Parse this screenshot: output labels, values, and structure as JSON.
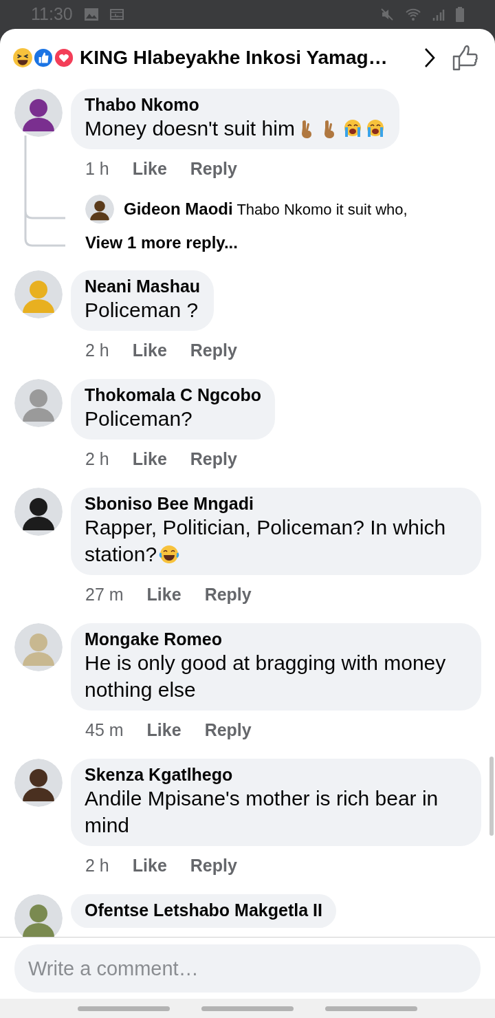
{
  "status_bar": {
    "time": "11:30"
  },
  "header": {
    "reactions": [
      {
        "kind": "haha"
      },
      {
        "kind": "like"
      },
      {
        "kind": "love"
      }
    ],
    "title": "KING Hlabeyakhe Inkosi Yamag…"
  },
  "comments": [
    {
      "author": "Thabo Nkomo",
      "text": "Money doesn't suit him",
      "emoji": [
        {
          "kind": "fingers"
        },
        {
          "kind": "fingers"
        },
        {
          "kind": "crying"
        },
        {
          "kind": "crying"
        }
      ],
      "time": "1 h",
      "like": "Like",
      "reply": "Reply",
      "color": "#7a2f8f",
      "replies": [
        {
          "author": "Gideon Maodi",
          "text": "Thabo Nkomo it suit who,",
          "color": "#5a3a1a"
        }
      ],
      "more_replies": "View 1 more reply..."
    },
    {
      "author": "Neani Mashau",
      "text": "Policeman ?",
      "time": "2 h",
      "like": "Like",
      "reply": "Reply",
      "color": "#e8b020"
    },
    {
      "author": "Thokomala C Ngcobo",
      "text": "Policeman?",
      "time": "2 h",
      "like": "Like",
      "reply": "Reply",
      "color": "#9a9a9a"
    },
    {
      "author": "Sboniso Bee Mngadi",
      "text": "Rapper, Politician, Policeman? In which station?",
      "emoji": [
        {
          "kind": "laughing"
        }
      ],
      "time": "27 m",
      "like": "Like",
      "reply": "Reply",
      "color": "#1c1c1c"
    },
    {
      "author": "Mongake Romeo",
      "text": "He is only good at bragging with money nothing else",
      "time": "45 m",
      "like": "Like",
      "reply": "Reply",
      "color": "#c8b890"
    },
    {
      "author": "Skenza Kgatlhego",
      "text": "Andile Mpisane's mother is rich bear in mind",
      "time": "2 h",
      "like": "Like",
      "reply": "Reply",
      "color": "#4a3020"
    },
    {
      "author": "Ofentse Letshabo Makgetla II",
      "color": "#7a8a50"
    }
  ],
  "composer": {
    "placeholder": "Write a comment…"
  }
}
